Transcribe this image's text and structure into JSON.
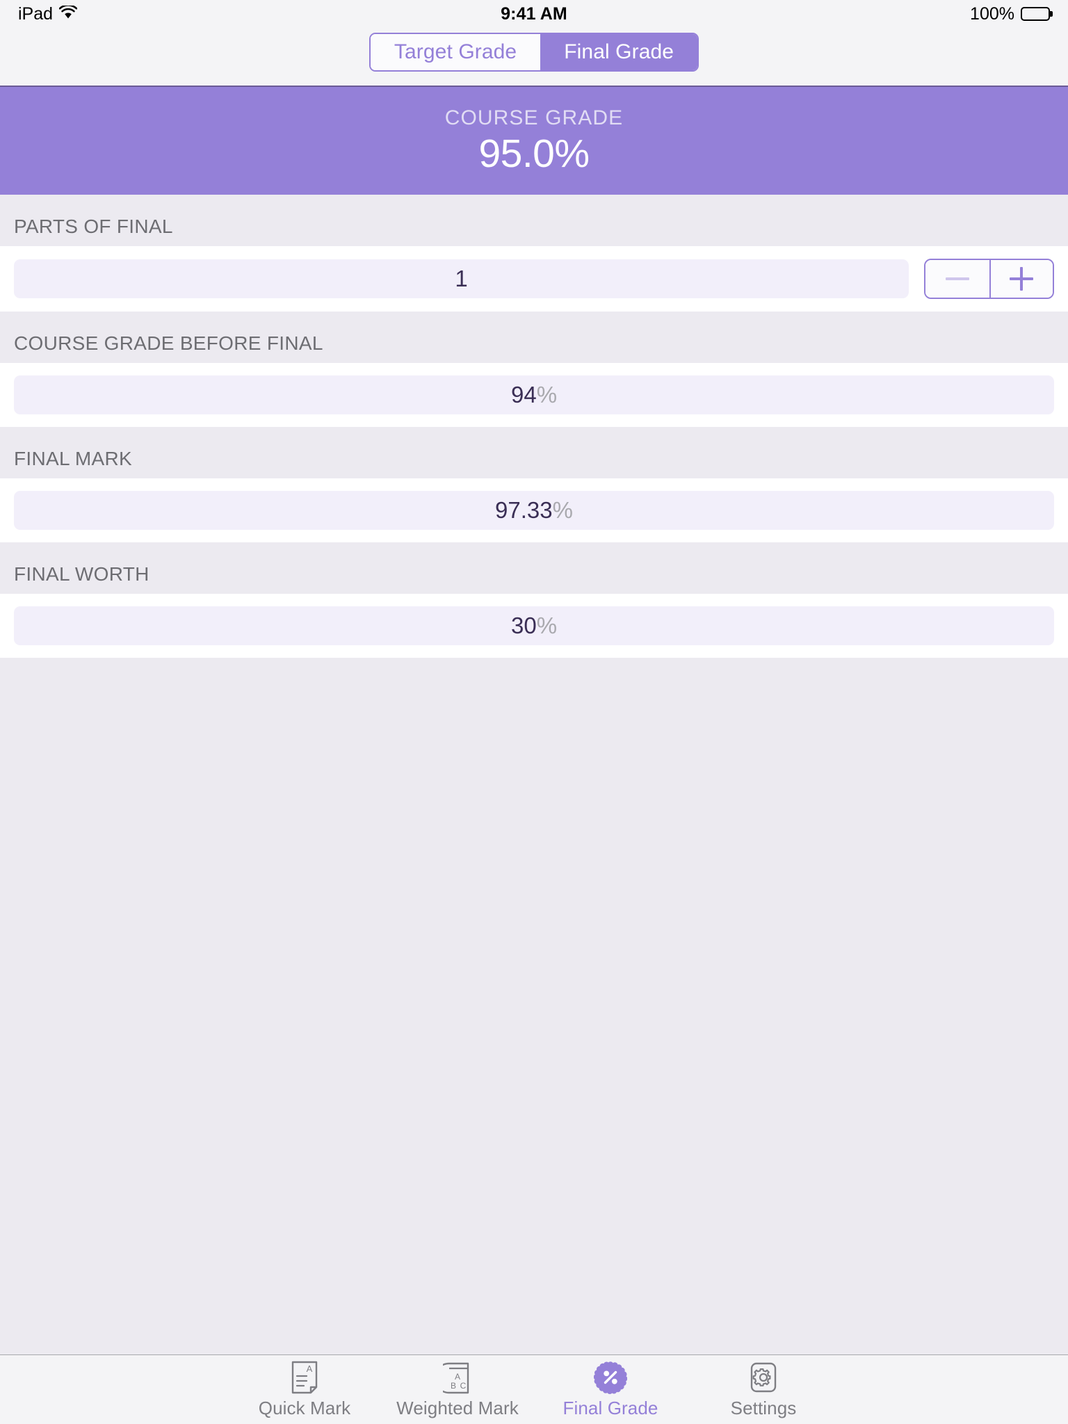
{
  "status_bar": {
    "device": "iPad",
    "wifi_icon": "wifi-icon",
    "time": "9:41 AM",
    "battery_percent": "100%",
    "battery_icon": "battery-full-icon"
  },
  "segmented_control": {
    "options": [
      {
        "label": "Target Grade",
        "selected": false
      },
      {
        "label": "Final Grade",
        "selected": true
      }
    ]
  },
  "header": {
    "label": "COURSE GRADE",
    "value": "95.0%"
  },
  "sections": [
    {
      "header": "PARTS OF FINAL",
      "type": "stepper",
      "value": "1",
      "suffix": "",
      "stepper": {
        "decrement_label": "−",
        "decrement_enabled": false,
        "increment_label": "+",
        "increment_enabled": true
      }
    },
    {
      "header": "COURSE GRADE BEFORE FINAL",
      "type": "value",
      "value": "94",
      "suffix": "%"
    },
    {
      "header": "FINAL MARK",
      "type": "value",
      "value": "97.33",
      "suffix": "%"
    },
    {
      "header": "FINAL WORTH",
      "type": "value",
      "value": "30",
      "suffix": "%"
    }
  ],
  "tab_bar": {
    "tabs": [
      {
        "label": "Quick Mark",
        "icon": "document-a-icon",
        "active": false
      },
      {
        "label": "Weighted Mark",
        "icon": "book-abc-icon",
        "active": false
      },
      {
        "label": "Final Grade",
        "icon": "percent-badge-icon",
        "active": true
      },
      {
        "label": "Settings",
        "icon": "gear-icon",
        "active": false
      }
    ]
  },
  "colors": {
    "accent_purple": "#9480d8",
    "field_background": "#f2effa",
    "page_background": "#eceaf0",
    "value_text": "#3a2e55",
    "suffix_text": "#a9a9ae",
    "section_header_text": "#6d6d72",
    "tab_inactive": "#7e7e83"
  }
}
